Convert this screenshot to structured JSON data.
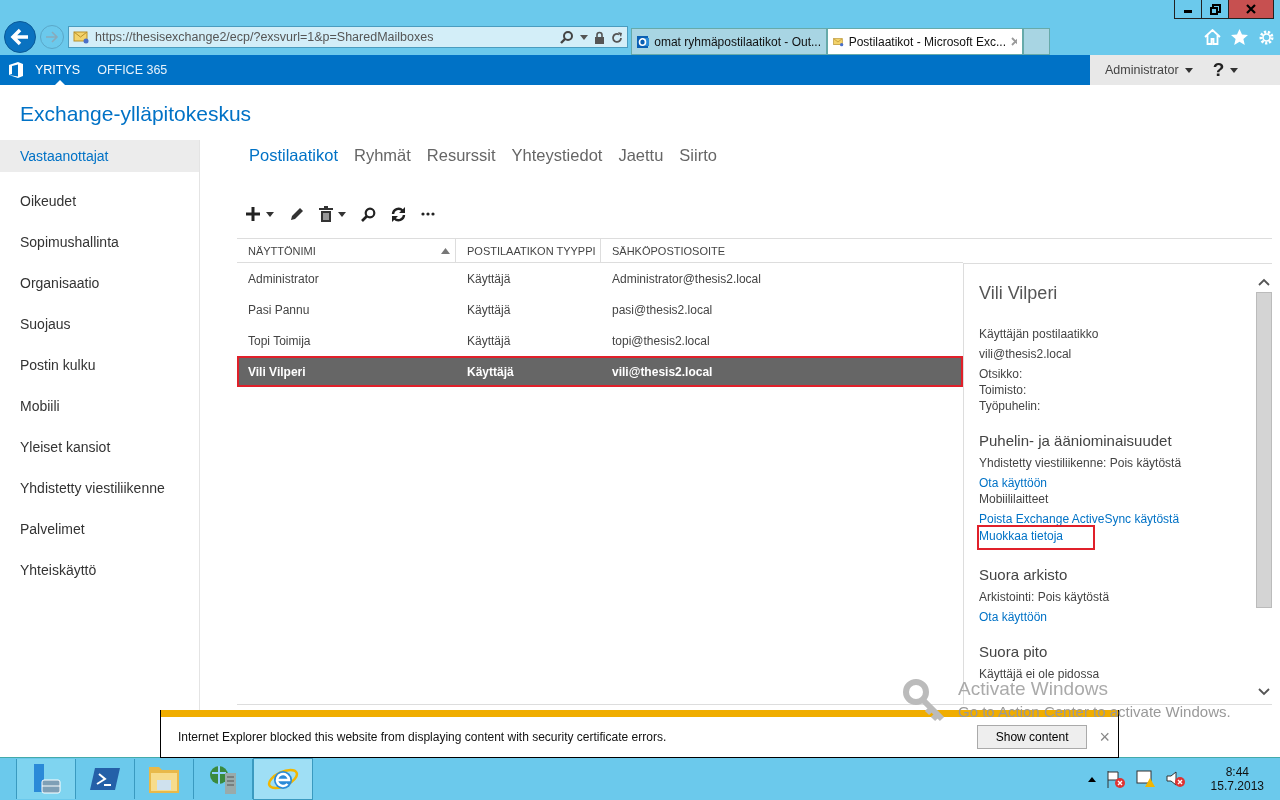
{
  "browser": {
    "address": "https://thesisexchange2/ecp/?exsvurl=1&p=SharedMailboxes",
    "tabs": [
      {
        "title": "omat ryhmäpostilaatikot - Out...",
        "kind": "outlook",
        "selected": false
      },
      {
        "title": "Postilaatikot - Microsoft Exc...",
        "kind": "exchange",
        "selected": true
      }
    ]
  },
  "nav": {
    "items": [
      {
        "label": "YRITYS",
        "selected": true
      },
      {
        "label": "OFFICE 365",
        "selected": false
      }
    ],
    "user": "Administrator",
    "help": "?"
  },
  "app_title": "Exchange-ylläpitokeskus",
  "sidebar": {
    "items": [
      {
        "label": "Vastaanottajat",
        "selected": true
      },
      {
        "label": "Oikeudet",
        "selected": false
      },
      {
        "label": "Sopimushallinta",
        "selected": false
      },
      {
        "label": "Organisaatio",
        "selected": false
      },
      {
        "label": "Suojaus",
        "selected": false
      },
      {
        "label": "Postin kulku",
        "selected": false
      },
      {
        "label": "Mobiili",
        "selected": false
      },
      {
        "label": "Yleiset kansiot",
        "selected": false
      },
      {
        "label": "Yhdistetty viestiliikenne",
        "selected": false
      },
      {
        "label": "Palvelimet",
        "selected": false
      },
      {
        "label": "Yhteiskäyttö",
        "selected": false
      }
    ]
  },
  "tabs": [
    {
      "label": "Postilaatikot",
      "selected": true
    },
    {
      "label": "Ryhmät",
      "selected": false
    },
    {
      "label": "Resurssit",
      "selected": false
    },
    {
      "label": "Yhteystiedot",
      "selected": false
    },
    {
      "label": "Jaettu",
      "selected": false
    },
    {
      "label": "Siirto",
      "selected": false
    }
  ],
  "table": {
    "columns": [
      {
        "label": "NÄYTTÖNIMI",
        "sorted": true
      },
      {
        "label": "POSTILAATIKON TYYPPI",
        "sorted": false
      },
      {
        "label": "SÄHKÖPOSTIOSOITE",
        "sorted": false
      }
    ],
    "rows": [
      {
        "cells": [
          "Administrator",
          "Käyttäjä",
          "Administrator@thesis2.local"
        ],
        "selected": false
      },
      {
        "cells": [
          "Pasi Pannu",
          "Käyttäjä",
          "pasi@thesis2.local"
        ],
        "selected": false
      },
      {
        "cells": [
          "Topi Toimija",
          "Käyttäjä",
          "topi@thesis2.local"
        ],
        "selected": false
      },
      {
        "cells": [
          "Vili Vilperi",
          "Käyttäjä",
          "vili@thesis2.local"
        ],
        "selected": true
      }
    ]
  },
  "details": {
    "name": "Vili Vilperi",
    "items": [
      {
        "kind": "text",
        "text": "Käyttäjän postilaatikko"
      },
      {
        "kind": "text",
        "text": "vili@thesis2.local"
      },
      {
        "kind": "field",
        "text": "Otsikko:"
      },
      {
        "kind": "field",
        "text": "Toimisto:"
      },
      {
        "kind": "field",
        "text": "Työpuhelin:"
      },
      {
        "kind": "heading",
        "text": "Puhelin- ja ääniominaisuudet"
      },
      {
        "kind": "text",
        "text": "Yhdistetty viestiliikenne: Pois käytöstä"
      },
      {
        "kind": "link",
        "text": "Ota käyttöön",
        "highlighted": false
      },
      {
        "kind": "text",
        "text": "Mobiililaitteet"
      },
      {
        "kind": "link",
        "text": "Poista Exchange ActiveSync käytöstä",
        "highlighted": false
      },
      {
        "kind": "link",
        "text": "Muokkaa tietoja",
        "highlighted": true
      },
      {
        "kind": "heading",
        "text": "Suora arkisto"
      },
      {
        "kind": "text",
        "text": "Arkistointi: Pois käytöstä"
      },
      {
        "kind": "link",
        "text": "Ota käyttöön",
        "highlighted": false
      },
      {
        "kind": "heading",
        "text": "Suora pito"
      },
      {
        "kind": "text",
        "text": "Käyttäjä ei ole pidossa"
      }
    ]
  },
  "notification": {
    "message": "Internet Explorer blocked this website from displaying content with security certificate errors.",
    "button": "Show content",
    "close": "×"
  },
  "watermark": {
    "title": "Activate Windows",
    "subtitle": "Go to Action Center to activate Windows."
  },
  "taskbar": {
    "apps": [
      {
        "kind": "server",
        "selected": false
      },
      {
        "kind": "shell",
        "selected": false
      },
      {
        "kind": "folder",
        "selected": false
      },
      {
        "kind": "network",
        "selected": false
      },
      {
        "kind": "ie",
        "selected": true
      }
    ],
    "time": "8:44",
    "date": "15.7.2013"
  }
}
